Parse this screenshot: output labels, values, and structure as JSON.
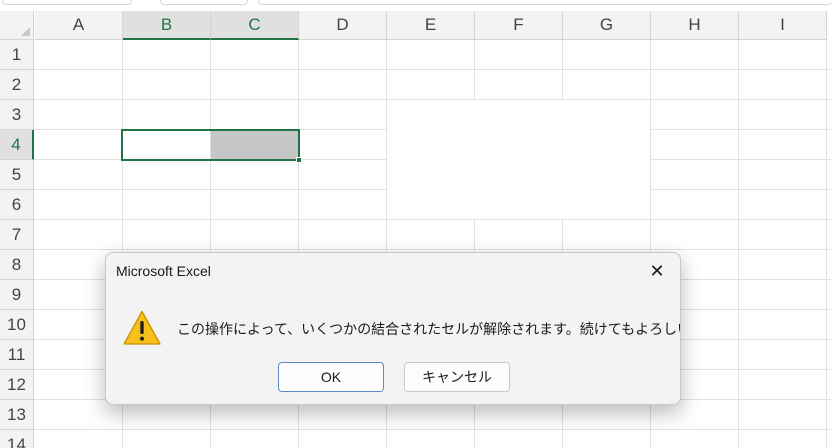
{
  "sheet": {
    "columns": [
      "A",
      "B",
      "C",
      "D",
      "E",
      "F",
      "G",
      "H",
      "I"
    ],
    "rows": [
      "1",
      "2",
      "3",
      "4",
      "5",
      "6",
      "7",
      "8",
      "9",
      "10",
      "11",
      "12",
      "13",
      "14"
    ],
    "selected_columns": [
      "B",
      "C"
    ],
    "selected_row": "4",
    "accent_color": "#217346"
  },
  "dialog": {
    "title": "Microsoft Excel",
    "close_glyph": "✕",
    "icon": "warning-icon",
    "message": "この操作によって、いくつかの結合されたセルが解除されます。続けてもよろしいですか?",
    "ok_label": "OK",
    "cancel_label": "キャンセル"
  }
}
